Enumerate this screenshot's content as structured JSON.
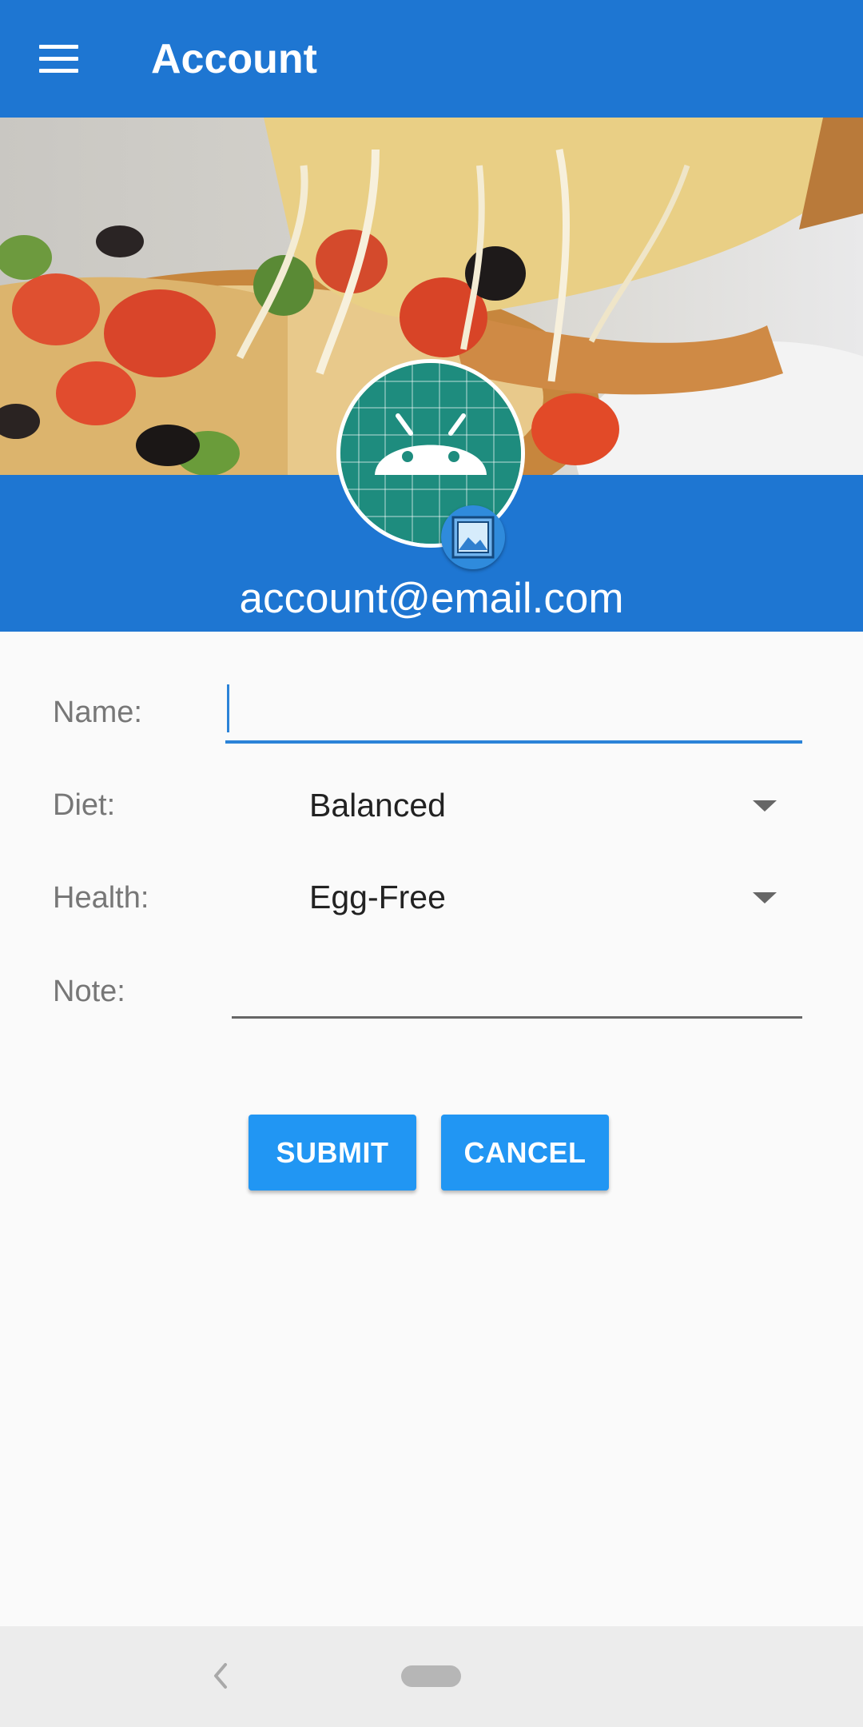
{
  "toolbar": {
    "title": "Account",
    "menu_icon": "hamburger-menu-icon",
    "color": "#1e76d2"
  },
  "header": {
    "background_image": "pizza-photo",
    "avatar_icon": "android-robot-icon",
    "avatar_color": "#1e8c7e",
    "edit_photo_icon": "image-icon",
    "email": "account@email.com"
  },
  "form": {
    "name": {
      "label": "Name:",
      "value": ""
    },
    "diet": {
      "label": "Diet:",
      "selected": "Balanced"
    },
    "health": {
      "label": "Health:",
      "selected": "Egg-Free"
    },
    "note": {
      "label": "Note:",
      "value": ""
    },
    "submit_label": "SUBMIT",
    "cancel_label": "CANCEL",
    "accent_color": "#2196f3"
  },
  "navigation": {
    "back_icon": "chevron-left-icon",
    "home_icon": "home-pill-icon"
  }
}
